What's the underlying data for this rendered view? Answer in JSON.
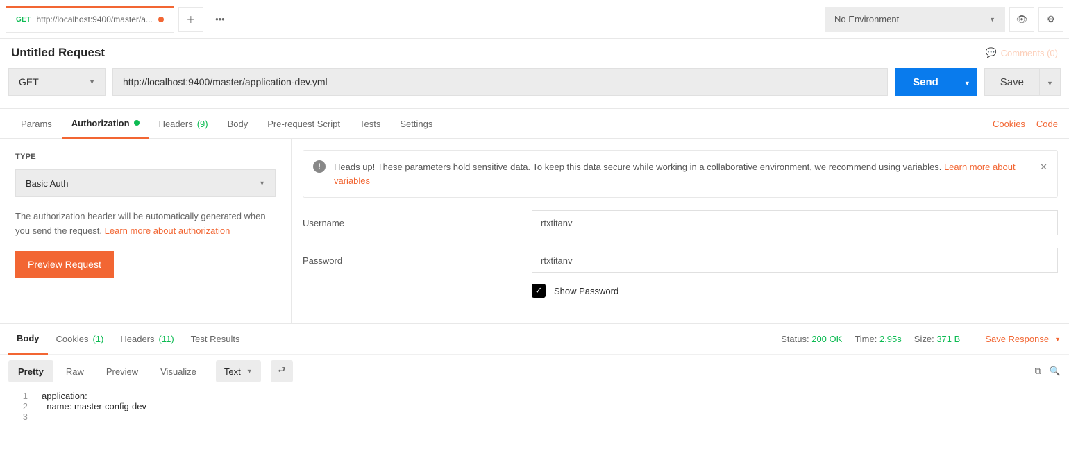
{
  "topbar": {
    "tab": {
      "method": "GET",
      "title": "http://localhost:9400/master/a..."
    },
    "env": "No Environment"
  },
  "request": {
    "title": "Untitled Request",
    "comments": "Comments (0)",
    "method": "GET",
    "url": "http://localhost:9400/master/application-dev.yml",
    "send": "Send",
    "save": "Save"
  },
  "sectionTabs": {
    "params": "Params",
    "auth": "Authorization",
    "headers": "Headers",
    "headersCount": "(9)",
    "body": "Body",
    "prereq": "Pre-request Script",
    "tests": "Tests",
    "settings": "Settings",
    "cookies": "Cookies",
    "code": "Code"
  },
  "auth": {
    "typeLabel": "TYPE",
    "type": "Basic Auth",
    "help1": "The authorization header will be automatically generated when you send the request. ",
    "help1link": "Learn more about authorization",
    "preview": "Preview Request",
    "alert1": "Heads up! These parameters hold sensitive data. To keep this data secure while working in a collaborative environment, we recommend using variables. ",
    "alertLink": "Learn more about variables",
    "usernameLabel": "Username",
    "username": "rtxtitanv",
    "passwordLabel": "Password",
    "password": "rtxtitanv",
    "showPwd": "Show Password"
  },
  "respTabs": {
    "body": "Body",
    "cookies": "Cookies",
    "cookiesCount": "(1)",
    "headers": "Headers",
    "headersCount": "(11)",
    "testResults": "Test Results"
  },
  "stats": {
    "statusLbl": "Status:",
    "status": "200 OK",
    "timeLbl": "Time:",
    "time": "2.95s",
    "sizeLbl": "Size:",
    "size": "371 B",
    "saveResp": "Save Response"
  },
  "view": {
    "pretty": "Pretty",
    "raw": "Raw",
    "preview": "Preview",
    "visualize": "Visualize",
    "format": "Text"
  },
  "body": {
    "l1": "application:",
    "l2": "  name: master-config-dev",
    "l3": ""
  }
}
